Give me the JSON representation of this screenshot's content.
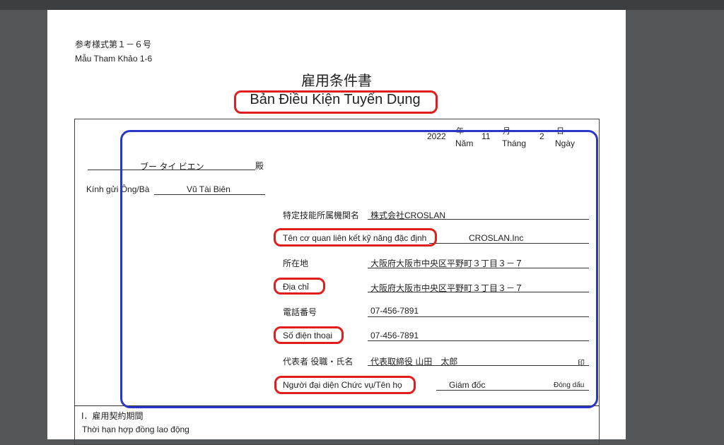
{
  "header": {
    "form_number_jp": "参考様式第１－６号",
    "form_number_vi": "Mẫu Tham Khảo 1-6"
  },
  "title": {
    "jp": "雇用条件書",
    "vi": "Bản Điều Kiện Tuyển Dụng"
  },
  "date": {
    "year": "2022",
    "year_jp": "年",
    "year_vi": "Năm",
    "month": "11",
    "month_jp": "月",
    "month_vi": "Tháng",
    "day": "2",
    "day_jp": "日",
    "day_vi": "Ngày"
  },
  "addressee": {
    "name_jp": "ブー タイ ビエン",
    "honorific_jp": "殿",
    "greeting_vi": "Kính gửi Ông/Bà",
    "name_vi": "Vũ Tài Biên"
  },
  "organization": {
    "name_label_jp": "特定技能所属機関名",
    "name_value_jp": "株式会社CROSLAN",
    "name_label_vi": "Tên cơ quan liên kết kỹ năng đặc định",
    "name_value_vi": "CROSLAN.Inc",
    "address_label_jp": "所在地",
    "address_value_jp": "大阪府大阪市中央区平野町３丁目３－７",
    "address_label_vi": "Địa chỉ",
    "address_value_vi": "大阪府大阪市中央区平野町３丁目３－７",
    "phone_label_jp": "電話番号",
    "phone_value_jp": "07-456-7891",
    "phone_label_vi": "Số điện thoại",
    "phone_value_vi": "07-456-7891",
    "rep_label_jp": "代表者 役職・氏名",
    "rep_value_jp": "代表取締役 山田　太郎",
    "seal_jp": "印",
    "rep_label_vi": "Người đại diện Chức vụ/Tên họ",
    "rep_value_vi": "Giám đốc",
    "seal_vi": "Đóng dấu"
  },
  "section1": {
    "heading_jp": "Ⅰ．雇用契約期間",
    "heading_vi": "Thời hạn hợp đồng lao động"
  },
  "colors": {
    "highlight_red": "#e01e1e",
    "highlight_blue": "#2a35c9",
    "viewer_bg": "#525659"
  }
}
